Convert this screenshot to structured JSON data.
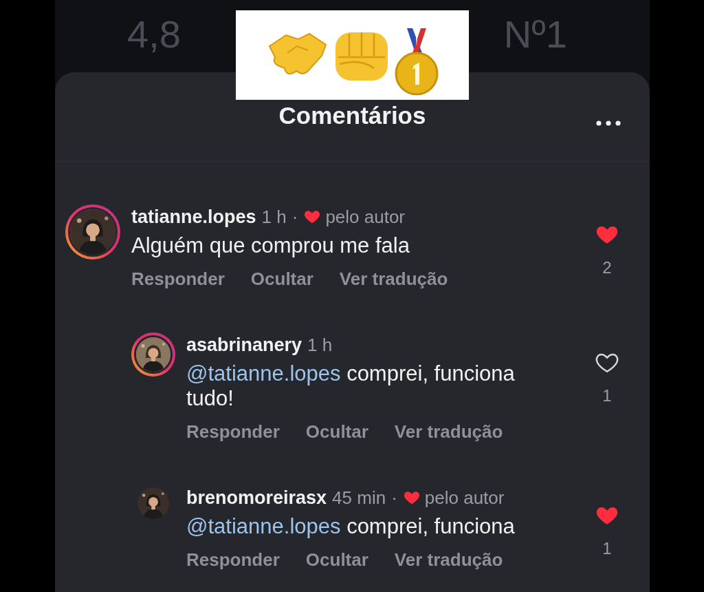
{
  "background": {
    "stats": [
      {
        "value": "4,8"
      },
      {
        "value": "Nº1"
      }
    ]
  },
  "sheet": {
    "title": "Comentários"
  },
  "comments": [
    {
      "username": "tatianne.lopes",
      "time": "1 h",
      "story_ring": true,
      "author_like": {
        "separator": "·",
        "label": "pelo autor"
      },
      "text": "Alguém que comprou me fala",
      "liked": true,
      "like_count": "2",
      "actions": [
        "Responder",
        "Ocultar",
        "Ver tradução"
      ],
      "replies": [
        {
          "username": "asabrinanery",
          "time": "1 h",
          "story_ring": true,
          "mention": "@tatianne.lopes",
          "text": "comprei, funciona tudo!",
          "liked": false,
          "like_count": "1",
          "actions": [
            "Responder",
            "Ocultar",
            "Ver tradução"
          ]
        },
        {
          "username": "brenomoreirasx",
          "time": "45 min",
          "story_ring": false,
          "author_like": {
            "separator": "·",
            "label": "pelo autor"
          },
          "mention": "@tatianne.lopes",
          "text": "comprei, funciona",
          "liked": true,
          "like_count": "1",
          "actions": [
            "Responder",
            "Ocultar",
            "Ver tradução"
          ]
        }
      ]
    }
  ]
}
